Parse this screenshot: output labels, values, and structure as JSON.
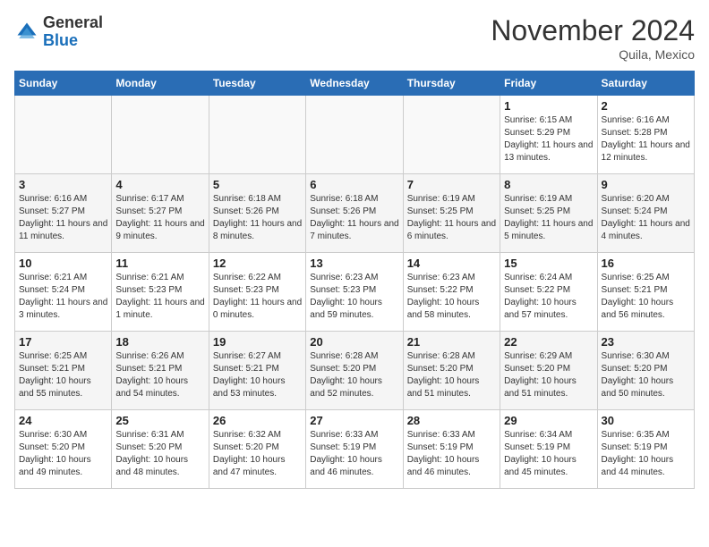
{
  "header": {
    "logo_general": "General",
    "logo_blue": "Blue",
    "month_title": "November 2024",
    "location": "Quila, Mexico"
  },
  "weekdays": [
    "Sunday",
    "Monday",
    "Tuesday",
    "Wednesday",
    "Thursday",
    "Friday",
    "Saturday"
  ],
  "weeks": [
    [
      {
        "day": "",
        "info": ""
      },
      {
        "day": "",
        "info": ""
      },
      {
        "day": "",
        "info": ""
      },
      {
        "day": "",
        "info": ""
      },
      {
        "day": "",
        "info": ""
      },
      {
        "day": "1",
        "info": "Sunrise: 6:15 AM\nSunset: 5:29 PM\nDaylight: 11 hours and 13 minutes."
      },
      {
        "day": "2",
        "info": "Sunrise: 6:16 AM\nSunset: 5:28 PM\nDaylight: 11 hours and 12 minutes."
      }
    ],
    [
      {
        "day": "3",
        "info": "Sunrise: 6:16 AM\nSunset: 5:27 PM\nDaylight: 11 hours and 11 minutes."
      },
      {
        "day": "4",
        "info": "Sunrise: 6:17 AM\nSunset: 5:27 PM\nDaylight: 11 hours and 9 minutes."
      },
      {
        "day": "5",
        "info": "Sunrise: 6:18 AM\nSunset: 5:26 PM\nDaylight: 11 hours and 8 minutes."
      },
      {
        "day": "6",
        "info": "Sunrise: 6:18 AM\nSunset: 5:26 PM\nDaylight: 11 hours and 7 minutes."
      },
      {
        "day": "7",
        "info": "Sunrise: 6:19 AM\nSunset: 5:25 PM\nDaylight: 11 hours and 6 minutes."
      },
      {
        "day": "8",
        "info": "Sunrise: 6:19 AM\nSunset: 5:25 PM\nDaylight: 11 hours and 5 minutes."
      },
      {
        "day": "9",
        "info": "Sunrise: 6:20 AM\nSunset: 5:24 PM\nDaylight: 11 hours and 4 minutes."
      }
    ],
    [
      {
        "day": "10",
        "info": "Sunrise: 6:21 AM\nSunset: 5:24 PM\nDaylight: 11 hours and 3 minutes."
      },
      {
        "day": "11",
        "info": "Sunrise: 6:21 AM\nSunset: 5:23 PM\nDaylight: 11 hours and 1 minute."
      },
      {
        "day": "12",
        "info": "Sunrise: 6:22 AM\nSunset: 5:23 PM\nDaylight: 11 hours and 0 minutes."
      },
      {
        "day": "13",
        "info": "Sunrise: 6:23 AM\nSunset: 5:23 PM\nDaylight: 10 hours and 59 minutes."
      },
      {
        "day": "14",
        "info": "Sunrise: 6:23 AM\nSunset: 5:22 PM\nDaylight: 10 hours and 58 minutes."
      },
      {
        "day": "15",
        "info": "Sunrise: 6:24 AM\nSunset: 5:22 PM\nDaylight: 10 hours and 57 minutes."
      },
      {
        "day": "16",
        "info": "Sunrise: 6:25 AM\nSunset: 5:21 PM\nDaylight: 10 hours and 56 minutes."
      }
    ],
    [
      {
        "day": "17",
        "info": "Sunrise: 6:25 AM\nSunset: 5:21 PM\nDaylight: 10 hours and 55 minutes."
      },
      {
        "day": "18",
        "info": "Sunrise: 6:26 AM\nSunset: 5:21 PM\nDaylight: 10 hours and 54 minutes."
      },
      {
        "day": "19",
        "info": "Sunrise: 6:27 AM\nSunset: 5:21 PM\nDaylight: 10 hours and 53 minutes."
      },
      {
        "day": "20",
        "info": "Sunrise: 6:28 AM\nSunset: 5:20 PM\nDaylight: 10 hours and 52 minutes."
      },
      {
        "day": "21",
        "info": "Sunrise: 6:28 AM\nSunset: 5:20 PM\nDaylight: 10 hours and 51 minutes."
      },
      {
        "day": "22",
        "info": "Sunrise: 6:29 AM\nSunset: 5:20 PM\nDaylight: 10 hours and 51 minutes."
      },
      {
        "day": "23",
        "info": "Sunrise: 6:30 AM\nSunset: 5:20 PM\nDaylight: 10 hours and 50 minutes."
      }
    ],
    [
      {
        "day": "24",
        "info": "Sunrise: 6:30 AM\nSunset: 5:20 PM\nDaylight: 10 hours and 49 minutes."
      },
      {
        "day": "25",
        "info": "Sunrise: 6:31 AM\nSunset: 5:20 PM\nDaylight: 10 hours and 48 minutes."
      },
      {
        "day": "26",
        "info": "Sunrise: 6:32 AM\nSunset: 5:20 PM\nDaylight: 10 hours and 47 minutes."
      },
      {
        "day": "27",
        "info": "Sunrise: 6:33 AM\nSunset: 5:19 PM\nDaylight: 10 hours and 46 minutes."
      },
      {
        "day": "28",
        "info": "Sunrise: 6:33 AM\nSunset: 5:19 PM\nDaylight: 10 hours and 46 minutes."
      },
      {
        "day": "29",
        "info": "Sunrise: 6:34 AM\nSunset: 5:19 PM\nDaylight: 10 hours and 45 minutes."
      },
      {
        "day": "30",
        "info": "Sunrise: 6:35 AM\nSunset: 5:19 PM\nDaylight: 10 hours and 44 minutes."
      }
    ]
  ]
}
